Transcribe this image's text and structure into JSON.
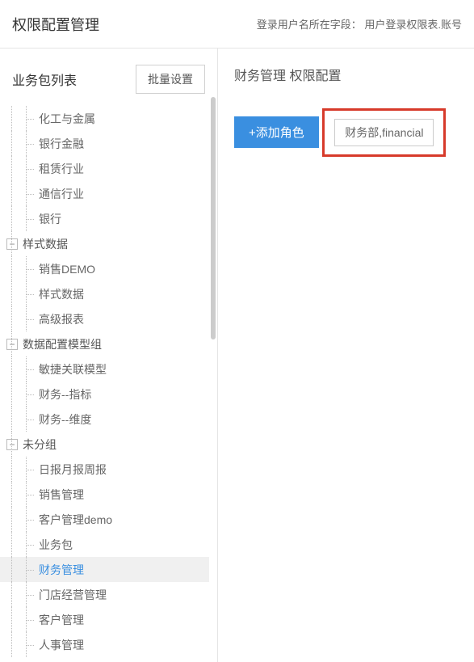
{
  "header": {
    "title": "权限配置管理",
    "login_label": "登录用户名所在字段：",
    "login_value": "用户登录权限表.账号"
  },
  "sidebar": {
    "title": "业务包列表",
    "batch_label": "批量设置",
    "groups": [
      {
        "name": "",
        "visible_header": false,
        "items": [
          "化工与金属",
          "银行金融",
          "租赁行业",
          "通信行业",
          "银行"
        ]
      },
      {
        "name": "样式数据",
        "visible_header": true,
        "items": [
          "销售DEMO",
          "样式数据",
          "高级报表"
        ]
      },
      {
        "name": "数据配置模型组",
        "visible_header": true,
        "items": [
          "敏捷关联模型",
          "财务--指标",
          "财务--维度"
        ]
      },
      {
        "name": "未分组",
        "visible_header": true,
        "items": [
          "日报月报周报",
          "销售管理",
          "客户管理demo",
          "业务包",
          "财务管理",
          "门店经营管理",
          "客户管理",
          "人事管理"
        ]
      }
    ],
    "selected": "财务管理"
  },
  "main": {
    "title_prefix": "财务管理",
    "title_suffix": "权限配置",
    "add_role_label": "+添加角色",
    "role_chip": "财务部,financial"
  }
}
